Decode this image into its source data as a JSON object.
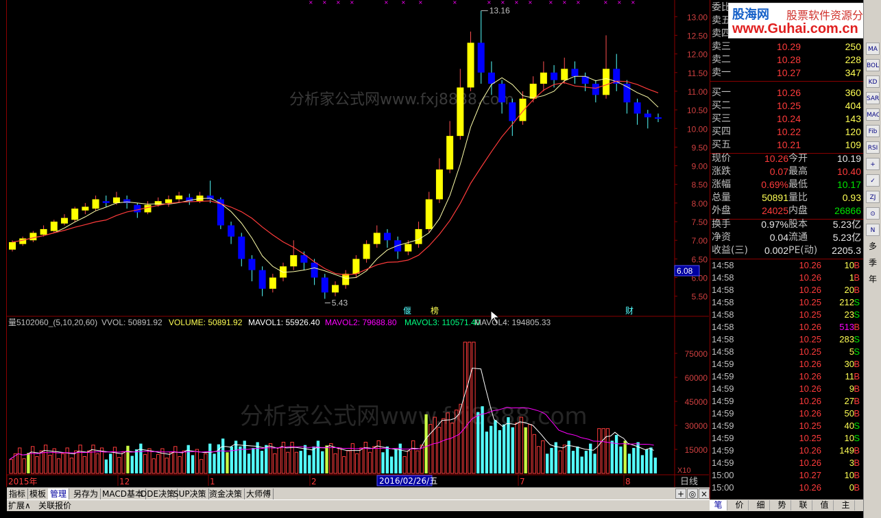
{
  "price_axis": [
    "13.00",
    "12.50",
    "12.00",
    "11.50",
    "11.00",
    "10.50",
    "10.00",
    "9.50",
    "9.00",
    "8.50",
    "8.00",
    "7.50",
    "7.00",
    "6.50",
    "6.00",
    "5.50"
  ],
  "current_price_tag": "6.08",
  "price_annotations": {
    "high": "13.16",
    "low": "5.43"
  },
  "event_markers": [
    "偃",
    "榜",
    "财"
  ],
  "watermark": "分析家公式网www.fxj8888.com",
  "volume_header": {
    "name": "量5102060_(5,10,20,60)",
    "vvol": "VVOL: 50891.92",
    "volume": "VOLUME: 50891.92",
    "mavol1": "MAVOL1: 55926.40",
    "mavol2": "MAVOL2: 79688.80",
    "mavol3": "MAVOL3: 110571.40",
    "mavol4": "MAVOL4: 194805.33"
  },
  "volume_axis": [
    "75000",
    "60000",
    "45000",
    "30000",
    "15000"
  ],
  "volume_unit": "X10",
  "date_axis": {
    "start": "2015年",
    "m12": "12",
    "m1": "1",
    "m2": "2",
    "cursor": "2016/02/26/五",
    "m7": "7",
    "m8": "8",
    "period": "日线"
  },
  "quote": {
    "title_label": "委比",
    "asks": [
      {
        "label": "卖五",
        "price": "",
        "vol": ""
      },
      {
        "label": "卖四",
        "price": "",
        "vol": ""
      },
      {
        "label": "卖三",
        "price": "10.29",
        "vol": "250"
      },
      {
        "label": "卖二",
        "price": "10.28",
        "vol": "228"
      },
      {
        "label": "卖一",
        "price": "10.27",
        "vol": "347"
      }
    ],
    "bids": [
      {
        "label": "买一",
        "price": "10.26",
        "vol": "360"
      },
      {
        "label": "买二",
        "price": "10.25",
        "vol": "404"
      },
      {
        "label": "买三",
        "price": "10.24",
        "vol": "143"
      },
      {
        "label": "买四",
        "price": "10.22",
        "vol": "120"
      },
      {
        "label": "买五",
        "price": "10.21",
        "vol": "109"
      }
    ],
    "stats": [
      {
        "l1": "现价",
        "v1": "10.26",
        "l2": "今开",
        "v2": "10.19"
      },
      {
        "l1": "涨跌",
        "v1": "0.07",
        "l2": "最高",
        "v2": "10.40"
      },
      {
        "l1": "涨幅",
        "v1": "0.69%",
        "l2": "最低",
        "v2": "10.17"
      },
      {
        "l1": "总量",
        "v1": "50891",
        "l2": "量比",
        "v2": "0.93"
      },
      {
        "l1": "外盘",
        "v1": "24025",
        "l2": "内盘",
        "v2": "26866"
      }
    ],
    "stats2": [
      {
        "l1": "换手",
        "v1": "0.97%",
        "l2": "股本",
        "v2": "5.23亿"
      },
      {
        "l1": "净资",
        "v1": "0.04",
        "l2": "流通",
        "v2": "5.23亿"
      },
      {
        "l1": "收益(三)",
        "v1": "0.002",
        "l2": "PE(动)",
        "v2": "2205.3"
      }
    ],
    "ticks": [
      {
        "t": "14:58",
        "p": "10.26",
        "v": "10",
        "s": "B"
      },
      {
        "t": "14:58",
        "p": "10.26",
        "v": "1",
        "s": "B"
      },
      {
        "t": "14:58",
        "p": "10.26",
        "v": "20",
        "s": "B"
      },
      {
        "t": "14:58",
        "p": "10.25",
        "v": "212",
        "s": "S"
      },
      {
        "t": "14:58",
        "p": "10.25",
        "v": "23",
        "s": "S"
      },
      {
        "t": "14:58",
        "p": "10.26",
        "v": "513",
        "s": "B"
      },
      {
        "t": "14:58",
        "p": "10.25",
        "v": "283",
        "s": "S"
      },
      {
        "t": "14:58",
        "p": "10.25",
        "v": "5",
        "s": "S"
      },
      {
        "t": "14:59",
        "p": "10.26",
        "v": "30",
        "s": "B"
      },
      {
        "t": "14:59",
        "p": "10.26",
        "v": "11",
        "s": "B"
      },
      {
        "t": "14:59",
        "p": "10.26",
        "v": "9",
        "s": "B"
      },
      {
        "t": "14:59",
        "p": "10.26",
        "v": "27",
        "s": "B"
      },
      {
        "t": "14:59",
        "p": "10.26",
        "v": "50",
        "s": "B"
      },
      {
        "t": "14:59",
        "p": "10.25",
        "v": "40",
        "s": "S"
      },
      {
        "t": "14:59",
        "p": "10.25",
        "v": "10",
        "s": "S"
      },
      {
        "t": "14:59",
        "p": "10.26",
        "v": "149",
        "s": "B"
      },
      {
        "t": "14:59",
        "p": "10.26",
        "v": "3",
        "s": "B"
      },
      {
        "t": "15:00",
        "p": "10.27",
        "v": "10",
        "s": "B"
      },
      {
        "t": "15:00",
        "p": "10.26",
        "v": "0",
        "s": "B"
      }
    ]
  },
  "logo": {
    "site": "股海网",
    "tagline": "股票软件资源分享",
    "url": "www.Guhai.com.cn"
  },
  "tabs": [
    "指标",
    "模板",
    "管理",
    "另存为",
    "MACD基本",
    "DDE决策",
    "SUP决策",
    "资金决策",
    "大师傅"
  ],
  "tab_controls": [
    "+",
    "◎",
    "×"
  ],
  "bottom_left": [
    "扩展∧",
    "关联报价"
  ],
  "quote_tabs": [
    "笔",
    "价",
    "细",
    "势",
    "联",
    "值",
    "主"
  ],
  "tools": [
    "MA",
    "BOLL",
    "KD",
    "SAR",
    "MACD",
    "Fib",
    "RSI",
    "+",
    "✓",
    "ZJ",
    "⊙",
    "N",
    "多",
    "季",
    "年"
  ],
  "colors": {
    "up": "#ff3b3b",
    "down": "#00e600",
    "yellow": "#ffff54",
    "candle_up_fill": "#ffff00",
    "candle_down_fill": "#0000ff",
    "axis": "#8b0000",
    "cyan": "#54ffff"
  },
  "chart_data": {
    "type": "candlestick",
    "price_range": [
      5.2,
      13.3
    ],
    "ma_lines": [
      "MA yellow",
      "MA red"
    ],
    "candles": [
      [
        6.75,
        6.95,
        6.7,
        7.0
      ],
      [
        6.9,
        7.05,
        6.85,
        7.1
      ],
      [
        7.0,
        7.2,
        6.95,
        7.25
      ],
      [
        7.15,
        7.3,
        7.1,
        7.4
      ],
      [
        7.25,
        7.5,
        7.2,
        7.55
      ],
      [
        7.45,
        7.6,
        7.4,
        7.7
      ],
      [
        7.55,
        7.85,
        7.5,
        7.9
      ],
      [
        7.8,
        7.9,
        7.7,
        8.0
      ],
      [
        7.85,
        8.1,
        7.8,
        8.2
      ],
      [
        8.05,
        8.0,
        7.9,
        8.2
      ],
      [
        8.0,
        8.15,
        7.95,
        8.3
      ],
      [
        8.1,
        8.0,
        7.85,
        8.2
      ],
      [
        7.95,
        7.75,
        7.6,
        8.0
      ],
      [
        7.75,
        7.95,
        7.7,
        8.05
      ],
      [
        7.95,
        8.05,
        7.9,
        8.15
      ],
      [
        8.0,
        8.1,
        7.9,
        8.2
      ],
      [
        8.1,
        8.2,
        8.0,
        8.3
      ],
      [
        8.15,
        8.05,
        7.95,
        8.25
      ],
      [
        8.05,
        8.2,
        8.0,
        8.3
      ],
      [
        8.2,
        8.1,
        8.0,
        8.6
      ],
      [
        8.1,
        7.4,
        7.3,
        8.15
      ],
      [
        7.4,
        7.1,
        6.9,
        7.5
      ],
      [
        7.1,
        6.5,
        6.3,
        7.2
      ],
      [
        6.5,
        6.2,
        5.9,
        6.6
      ],
      [
        6.2,
        5.7,
        5.5,
        6.3
      ],
      [
        5.7,
        6.0,
        5.6,
        6.1
      ],
      [
        6.0,
        6.3,
        5.9,
        6.4
      ],
      [
        6.3,
        6.6,
        6.2,
        7.0
      ],
      [
        6.6,
        6.4,
        6.2,
        6.7
      ],
      [
        6.4,
        6.0,
        5.8,
        6.5
      ],
      [
        6.0,
        5.6,
        5.43,
        6.1
      ],
      [
        5.6,
        5.8,
        5.5,
        5.9
      ],
      [
        5.8,
        6.1,
        5.7,
        6.2
      ],
      [
        6.1,
        6.5,
        6.0,
        6.6
      ],
      [
        6.5,
        6.9,
        6.4,
        7.0
      ],
      [
        6.9,
        7.2,
        6.8,
        7.4
      ],
      [
        7.2,
        7.0,
        6.8,
        7.3
      ],
      [
        7.0,
        6.7,
        6.5,
        7.1
      ],
      [
        6.7,
        6.9,
        6.6,
        7.0
      ],
      [
        6.9,
        7.3,
        6.8,
        7.5
      ],
      [
        7.3,
        8.1,
        7.2,
        8.3
      ],
      [
        8.1,
        8.9,
        8.0,
        9.2
      ],
      [
        8.9,
        9.8,
        8.8,
        10.2
      ],
      [
        9.8,
        11.1,
        9.7,
        11.6
      ],
      [
        11.1,
        12.3,
        11.0,
        12.6
      ],
      [
        12.3,
        11.5,
        11.2,
        13.16
      ],
      [
        11.5,
        11.2,
        10.9,
        11.8
      ],
      [
        11.2,
        10.7,
        10.4,
        11.3
      ],
      [
        10.7,
        10.2,
        9.8,
        10.8
      ],
      [
        10.2,
        10.8,
        10.1,
        11.0
      ],
      [
        10.8,
        11.2,
        10.7,
        11.4
      ],
      [
        11.2,
        11.5,
        11.0,
        11.8
      ],
      [
        11.5,
        11.3,
        11.1,
        11.7
      ],
      [
        11.3,
        11.6,
        11.2,
        11.9
      ],
      [
        11.6,
        11.4,
        11.2,
        11.8
      ],
      [
        11.4,
        11.2,
        11.0,
        11.5
      ],
      [
        11.2,
        10.9,
        10.7,
        11.3
      ],
      [
        10.9,
        11.6,
        10.8,
        12.5
      ],
      [
        11.6,
        11.2,
        11.0,
        12.0
      ],
      [
        11.2,
        10.7,
        10.4,
        11.3
      ],
      [
        10.7,
        10.4,
        10.1,
        10.8
      ],
      [
        10.4,
        10.3,
        10.0,
        10.5
      ],
      [
        10.3,
        10.26,
        10.17,
        10.4
      ]
    ]
  }
}
